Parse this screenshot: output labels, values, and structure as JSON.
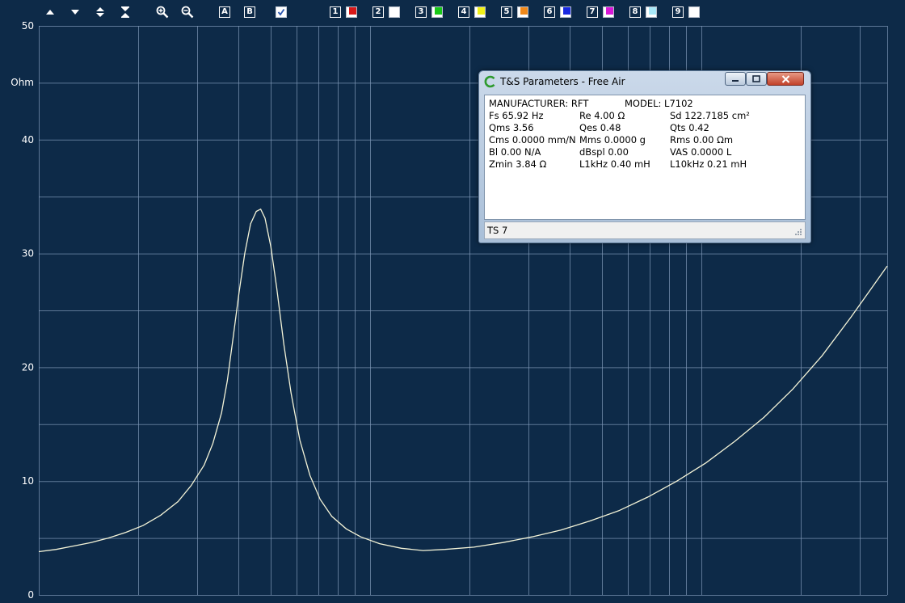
{
  "toolbar": {
    "buttons": [
      {
        "name": "move-up-icon",
        "label": ""
      },
      {
        "name": "move-down-icon",
        "label": ""
      },
      {
        "name": "expand-vertical-icon",
        "label": ""
      },
      {
        "name": "compress-vertical-icon",
        "label": ""
      },
      {
        "name": "zoom-in-icon",
        "label": ""
      },
      {
        "name": "zoom-out-icon",
        "label": ""
      },
      {
        "name": "cursor-a-button",
        "label": "A"
      },
      {
        "name": "cursor-b-button",
        "label": "B"
      },
      {
        "name": "checkbox-icon",
        "label": ""
      }
    ],
    "traces": [
      {
        "label": "1",
        "color": "#d81818"
      },
      {
        "label": "2",
        "color": "#ffffff"
      },
      {
        "label": "3",
        "color": "#18c818"
      },
      {
        "label": "4",
        "color": "#f0f018"
      },
      {
        "label": "5",
        "color": "#f08818"
      },
      {
        "label": "6",
        "color": "#1828e0"
      },
      {
        "label": "7",
        "color": "#d818d8"
      },
      {
        "label": "8",
        "color": "#a8e8f8"
      },
      {
        "label": "9",
        "color": "#ffffff"
      }
    ]
  },
  "chart_data": {
    "type": "line",
    "ylabel": "Ohm",
    "ylim": [
      0,
      50
    ],
    "yticks": [
      "0",
      "10",
      "20",
      "30",
      "40",
      "50"
    ],
    "x_scale": "log",
    "grid": true,
    "line_color": "#f4f4d8",
    "series": [
      {
        "points": [
          [
            0,
            3.8
          ],
          [
            24,
            4.0
          ],
          [
            48,
            4.3
          ],
          [
            72,
            4.6
          ],
          [
            96,
            5.0
          ],
          [
            120,
            5.5
          ],
          [
            144,
            6.1
          ],
          [
            168,
            7.0
          ],
          [
            192,
            8.2
          ],
          [
            210,
            9.6
          ],
          [
            228,
            11.4
          ],
          [
            240,
            13.3
          ],
          [
            252,
            16.0
          ],
          [
            260,
            18.8
          ],
          [
            268,
            22.6
          ],
          [
            276,
            26.5
          ],
          [
            284,
            30.0
          ],
          [
            292,
            32.6
          ],
          [
            300,
            33.7
          ],
          [
            306,
            33.9
          ],
          [
            312,
            33.1
          ],
          [
            320,
            30.6
          ],
          [
            328,
            27.0
          ],
          [
            338,
            22.0
          ],
          [
            348,
            17.7
          ],
          [
            360,
            13.6
          ],
          [
            374,
            10.5
          ],
          [
            388,
            8.4
          ],
          [
            404,
            6.9
          ],
          [
            424,
            5.8
          ],
          [
            444,
            5.1
          ],
          [
            470,
            4.5
          ],
          [
            500,
            4.1
          ],
          [
            530,
            3.9
          ],
          [
            560,
            4.0
          ],
          [
            600,
            4.2
          ],
          [
            640,
            4.6
          ],
          [
            680,
            5.1
          ],
          [
            720,
            5.7
          ],
          [
            760,
            6.5
          ],
          [
            800,
            7.4
          ],
          [
            840,
            8.6
          ],
          [
            880,
            10.0
          ],
          [
            920,
            11.6
          ],
          [
            960,
            13.5
          ],
          [
            1000,
            15.6
          ],
          [
            1040,
            18.1
          ],
          [
            1080,
            21.0
          ],
          [
            1120,
            24.4
          ],
          [
            1150,
            27.1
          ],
          [
            1170,
            28.9
          ]
        ]
      }
    ]
  },
  "ts_window": {
    "title": "T&S Parameters - Free Air",
    "rows": [
      [
        "MANUFACTURER:  RFT",
        "",
        "MODEL:  L7102"
      ],
      [
        "Fs  65.92 Hz",
        "Re  4.00 Ω",
        "Sd  122.7185 cm²"
      ],
      [
        "Qms 3.56",
        "Qes 0.48",
        "Qts 0.42"
      ],
      [
        "Cms 0.0000 mm/N",
        "Mms 0.0000 g",
        "Rms 0.00 Ωm"
      ],
      [
        "Bl   0.00 N/A",
        "dBspl 0.00",
        "VAS  0.0000 L"
      ],
      [
        "Zmin   3.84 Ω",
        "L1kHz  0.40 mH",
        "L10kHz 0.21 mH"
      ]
    ],
    "status": "TS 7"
  }
}
